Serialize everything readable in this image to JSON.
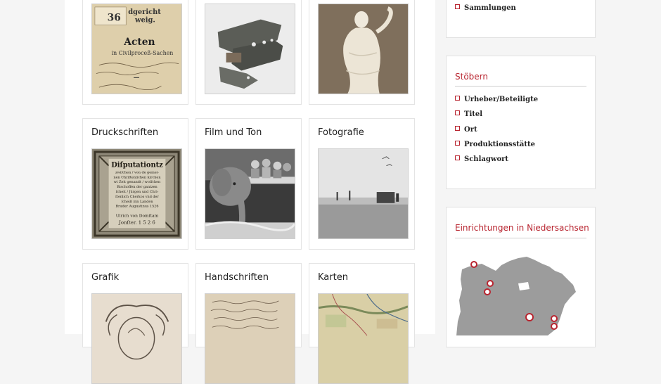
{
  "categories": {
    "druckschriften": "Druckschriften",
    "film_und_ton": "Film und Ton",
    "fotografie": "Fotografie",
    "grafik": "Grafik",
    "handschriften": "Handschriften",
    "karten": "Karten"
  },
  "archive_doc": {
    "heading": "Acten",
    "subheading": "in Civilproceß-Sachen",
    "number": "36",
    "court_fragment": "dgericht",
    "court_fragment2": "weig."
  },
  "book_cover": {
    "lines": [
      "Diſputationtz",
      "zwiſchen / von de gemei-",
      "nen Chriſtenlichen kirchen",
      "wi Zeit genandt / wolſchen",
      "Bischoffen der gantzen",
      "ſcheit / Jürgen und Chri-",
      "ſtenlich Cherkos vnd der",
      "ſcheiß inn Landen",
      "Bruder Augustinus 1526",
      "Ulrich von Domſtam",
      "Jonſter. 1 5 2 6"
    ]
  },
  "sidebar": {
    "top_link": "Sammlungen",
    "browse_title": "Stöbern",
    "browse_links": [
      "Urheber/Beteiligte",
      "Titel",
      "Ort",
      "Produktionsstätte",
      "Schlagwort"
    ],
    "map_title": "Einrichtungen in Niedersachsen",
    "map_color": "#9c9c9c",
    "marker_color": "#b8242f"
  },
  "colors": {
    "accent": "#b8242f"
  }
}
